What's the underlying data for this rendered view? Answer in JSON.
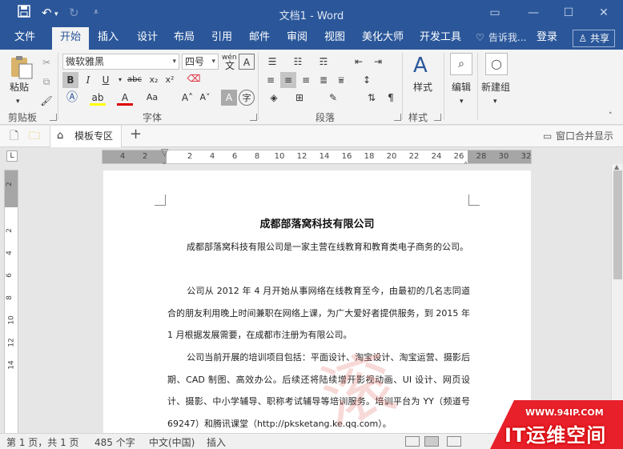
{
  "titlebar": {
    "title": "文档1 - Word",
    "save_icon": "save-icon",
    "undo_icon": "undo-icon",
    "redo_icon": "redo-icon",
    "customize_icon": "customize-icon"
  },
  "tabs": [
    {
      "label": "文件"
    },
    {
      "label": "开始"
    },
    {
      "label": "插入"
    },
    {
      "label": "设计"
    },
    {
      "label": "布局"
    },
    {
      "label": "引用"
    },
    {
      "label": "邮件"
    },
    {
      "label": "审阅"
    },
    {
      "label": "视图"
    },
    {
      "label": "美化大师"
    },
    {
      "label": "开发工具"
    }
  ],
  "tellme": "告诉我...",
  "login": "登录",
  "share": "共享",
  "ribbon": {
    "clipboard": {
      "paste": "粘贴",
      "label": "剪贴板"
    },
    "font": {
      "name": "微软雅黑",
      "size": "四号",
      "label": "字体",
      "wen": "wén",
      "wen_char": "文",
      "A": "A"
    },
    "paragraph": {
      "label": "段落"
    },
    "styles": {
      "button": "样式",
      "label": "样式"
    },
    "editing": {
      "button": "编辑"
    },
    "newgroup": {
      "button": "新建组"
    }
  },
  "docstrip": {
    "template_tab": "模板专区",
    "add": "+",
    "merge": "窗口合并显示"
  },
  "ruler": {
    "h_ticks": [
      "4",
      "2",
      "2",
      "4",
      "6",
      "8",
      "10",
      "12",
      "14",
      "16",
      "18",
      "20",
      "22",
      "24",
      "26",
      "28",
      "30",
      "32"
    ],
    "v_ticks": [
      "2",
      "2",
      "4",
      "6",
      "8",
      "10",
      "12",
      "14"
    ]
  },
  "document": {
    "title": "成都部落窝科技有限公司",
    "paragraphs": [
      "成都部落窝科技有限公司是一家主营在线教育和教育类电子商务的公司。",
      "公司从 2012 年 4 月开始从事网络在线教育至今，由最初的几名志同道合的朋友利用晚上时间兼职在网络上课，为广大爱好者提供服务，到 2015 年 1 月根据发展需要，在成都市注册为有限公司。",
      "公司当前开展的培训项目包括：平面设计、淘宝设计、淘宝运营、摄影后期、CAD 制图、高效办公。后续还将陆续增开影视动画、UI 设计、网页设计、摄影、中小学辅导、职称考试辅导等培训服务。培训平台为 YY（频道号 69247）和腾讯课堂（http://pksketang.ke.qq.com）。"
    ]
  },
  "status": {
    "page": "第 1 页，共 1 页",
    "words": "485 个字",
    "lang": "中文(中国)",
    "mode": "插入"
  },
  "watermark": {
    "stamp": "滚",
    "url": "WWW.94IP.COM",
    "name": "IT运维空间"
  }
}
